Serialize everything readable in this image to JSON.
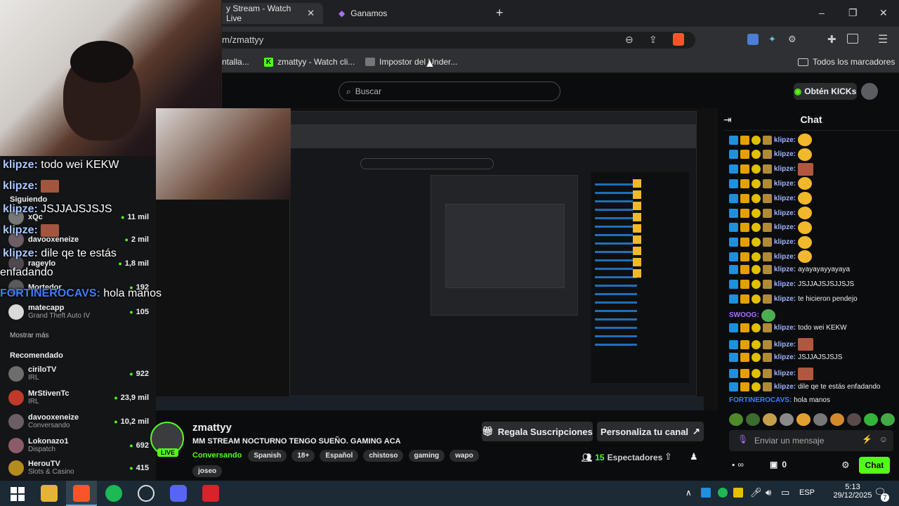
{
  "browser": {
    "tabs": [
      {
        "title": "y Stream - Watch Live",
        "close": "✕"
      },
      {
        "title": "Ganamos"
      }
    ],
    "new_tab": "+",
    "url": "m/zmattyy",
    "bookmarks": [
      "ntalla...",
      "zmattyy - Watch cli...",
      "Impostor del Under..."
    ],
    "all_bookmarks": "Todos los marcadores",
    "window_controls": [
      "–",
      "❐",
      "✕"
    ]
  },
  "header": {
    "search_placeholder": "Buscar",
    "get_kicks": "Obtén KICKs"
  },
  "overlay": [
    {
      "user": "klipze:",
      "text": " todo wei KEKW"
    },
    {
      "user": "klipze:",
      "text": ""
    },
    {
      "user": "klipze:",
      "text": " JSJJAJSJSJS"
    },
    {
      "user": "klipze:",
      "text": ""
    },
    {
      "user": "klipze:",
      "text": " dile qe te estás"
    },
    {
      "user": "",
      "text": "enfadando"
    },
    {
      "user": "FORTINEROCAVS:",
      "text": " hola manos"
    }
  ],
  "sidebar": {
    "following_heading": "Siguiendo",
    "following": [
      {
        "name": "xQc",
        "sub": "",
        "count": "11 mil"
      },
      {
        "name": "davooxeneize",
        "sub": "",
        "count": "2 mil"
      },
      {
        "name": "rageylo",
        "sub": "",
        "count": "1,8 mil"
      },
      {
        "name": "Mortedor",
        "sub": "",
        "count": "192"
      },
      {
        "name": "matecapp",
        "sub": "Grand Theft Auto IV",
        "count": "105"
      }
    ],
    "show_more": "Mostrar más",
    "recommended_heading": "Recomendado",
    "recommended": [
      {
        "name": "ciriloTV",
        "sub": "IRL",
        "count": "922"
      },
      {
        "name": "MrStivenTc",
        "sub": "IRL",
        "count": "23,9 mil"
      },
      {
        "name": "davooxeneize",
        "sub": "Conversando",
        "count": "10,2 mil"
      },
      {
        "name": "Lokonazo1",
        "sub": "Dispatch",
        "count": "692"
      },
      {
        "name": "HerouTV",
        "sub": "Slots & Casino",
        "count": "415"
      }
    ]
  },
  "stream": {
    "channel": "zmattyy",
    "live_badge": "LIVE",
    "title": "MM STREAM NOCTURNO TENGO SUEÑO. GAMING ACA",
    "category": "Conversando",
    "tags": [
      "Spanish",
      "18+",
      "Español",
      "chistoso",
      "gaming",
      "wapo",
      "joseo"
    ],
    "gift_subs": "Regala Suscripciones",
    "customize": "Personaliza tu canal",
    "viewers": "15",
    "viewers_label": "Espectadores"
  },
  "chat": {
    "title": "Chat",
    "messages": [
      {
        "user": "klipze:",
        "text": "",
        "emote": "face"
      },
      {
        "user": "klipze:",
        "text": "",
        "emote": "face"
      },
      {
        "user": "klipze:",
        "text": "",
        "emote": "red"
      },
      {
        "user": "klipze:",
        "text": "",
        "emote": "face"
      },
      {
        "user": "klipze:",
        "text": "",
        "emote": "face"
      },
      {
        "user": "klipze:",
        "text": "",
        "emote": "face"
      },
      {
        "user": "klipze:",
        "text": "",
        "emote": "face"
      },
      {
        "user": "klipze:",
        "text": "",
        "emote": "face"
      },
      {
        "user": "klipze:",
        "text": "",
        "emote": "face"
      },
      {
        "user": "klipze:",
        "text": "ayayayayyayaya",
        "emote": ""
      },
      {
        "user": "klipze:",
        "text": "JSJJAJSJSJJSJS",
        "emote": ""
      },
      {
        "user": "klipze:",
        "text": "te hicieron pendejo",
        "emote": ""
      },
      {
        "user": "SWOOG:",
        "text": "",
        "emote": "green"
      },
      {
        "user": "klipze:",
        "text": "todo wei KEKW",
        "emote": ""
      },
      {
        "user": "klipze:",
        "text": "",
        "emote": "red"
      },
      {
        "user": "klipze:",
        "text": "JSJJAJSJSJS",
        "emote": ""
      },
      {
        "user": "klipze:",
        "text": "",
        "emote": "red"
      },
      {
        "user": "klipze:",
        "text": "dile qe te estás enfadando",
        "emote": ""
      },
      {
        "user": "FORTINEROCAVS:",
        "text": "hola manos",
        "emote": ""
      }
    ],
    "input_placeholder": "Enviar un mensaje",
    "send_label": "Chat",
    "kicks_count": "0",
    "loop_symbol": "∞"
  },
  "taskbar": {
    "lang": "ESP",
    "time": "5:13",
    "date": "29/12/2025",
    "notifications": "7"
  },
  "colors": {
    "kick_green": "#53fc18",
    "chat_user": "#9fb6ff",
    "bg": "#0b0c0e"
  }
}
